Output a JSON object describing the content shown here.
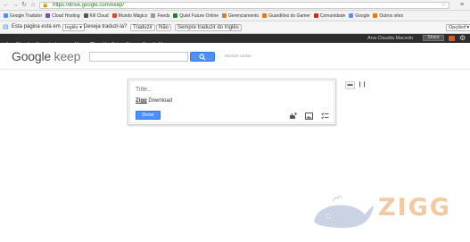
{
  "browser": {
    "url": "https://drive.google.com/keep/",
    "bookmarks": [
      {
        "label": "Google Tradutor",
        "color": "#4d90fe"
      },
      {
        "label": "Cloud Hosting",
        "color": "#7a4cb3"
      },
      {
        "label": "Kill Cloud",
        "color": "#555555"
      },
      {
        "label": "Mundo Mágico",
        "color": "#d04b2f"
      },
      {
        "label": "Feeds",
        "color": "#999999"
      },
      {
        "label": "Quiet Future Online",
        "color": "#2f7a2f"
      },
      {
        "label": "Gerenciamento",
        "color": "#e07a1a"
      },
      {
        "label": "Guardiões do Gamer",
        "color": "#e07a1a"
      },
      {
        "label": "Comunidade",
        "color": "#cc2a2a"
      },
      {
        "label": "Google",
        "color": "#4d90fe"
      },
      {
        "label": "Outros sites",
        "color": "#e07a1a"
      }
    ]
  },
  "translate_bar": {
    "text_prefix": "Esta página está em",
    "language": "Inglês",
    "question": "Deseja traduzi-la?",
    "translate_label": "Traduzir",
    "no_label": "Não",
    "never_label": "Sempre traduzir do Inglês",
    "options_label": "Opções"
  },
  "google_bar": {
    "items": [
      "+Ana Claudia",
      "Search",
      "Images",
      "Maps",
      "Play",
      "YouTube",
      "News",
      "Gmail",
      "More"
    ],
    "active_index": 4,
    "more_suffix": "▾",
    "user_name": "Ana Claudia Macedo",
    "share_label": "Share"
  },
  "keep": {
    "logo_google": "Google",
    "logo_keep": "keep",
    "search_placeholder": "",
    "search_hint": "Mostrar contas"
  },
  "note": {
    "title_placeholder": "Title...",
    "body_app": "Zigg",
    "body_rest": " Download",
    "done_label": "Done"
  },
  "icons": {
    "reminder": "remind-hand-icon",
    "image": "image-icon",
    "checklist": "checklist-icon",
    "list_view": "list-view-icon",
    "grid_view": "grid-view-icon",
    "whale": "whale-icon"
  },
  "watermark": {
    "text": "ZIGG",
    "color": "#f3c9a1"
  }
}
